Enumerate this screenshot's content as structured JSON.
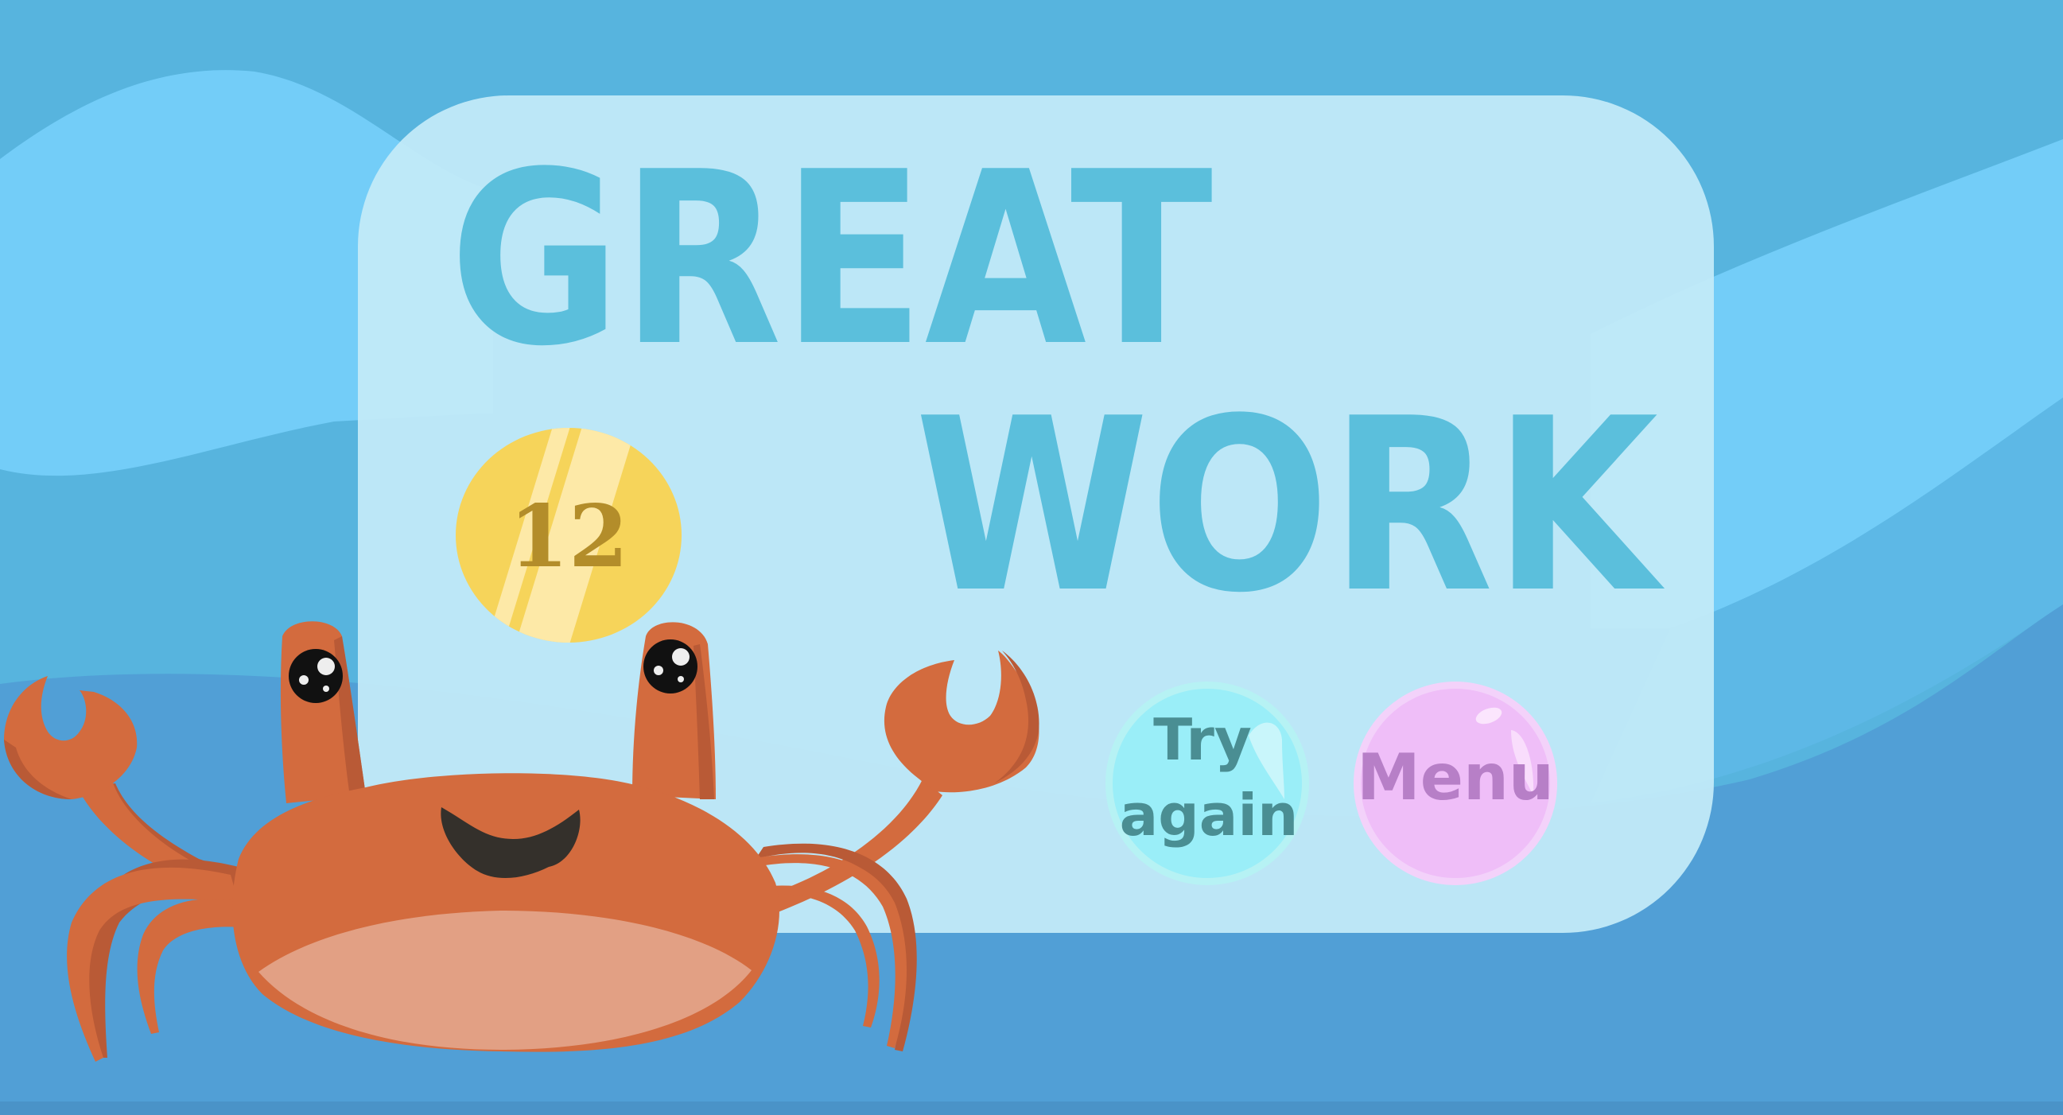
{
  "title": {
    "line1": "GREAT",
    "line2": "WORK"
  },
  "score": {
    "value": "12"
  },
  "buttons": {
    "try_again_line1": "Try",
    "try_again_line2": "again",
    "menu_label": "Menu"
  },
  "colors": {
    "sky_top": "#57b4de",
    "wave_light": "#73cdf8",
    "wave_mid": "#5db8e6",
    "sea_deep": "#519fd6",
    "panel": "#c2eaf8",
    "title": "#5bbfdc",
    "coin": "#f6d45a",
    "coin_text": "#b38d2a",
    "try_again": "#9aeef8",
    "menu": "#efbef8",
    "crab": "#d36b3e"
  },
  "icons": {
    "character": "crab-mascot",
    "coin": "gold-coin"
  }
}
